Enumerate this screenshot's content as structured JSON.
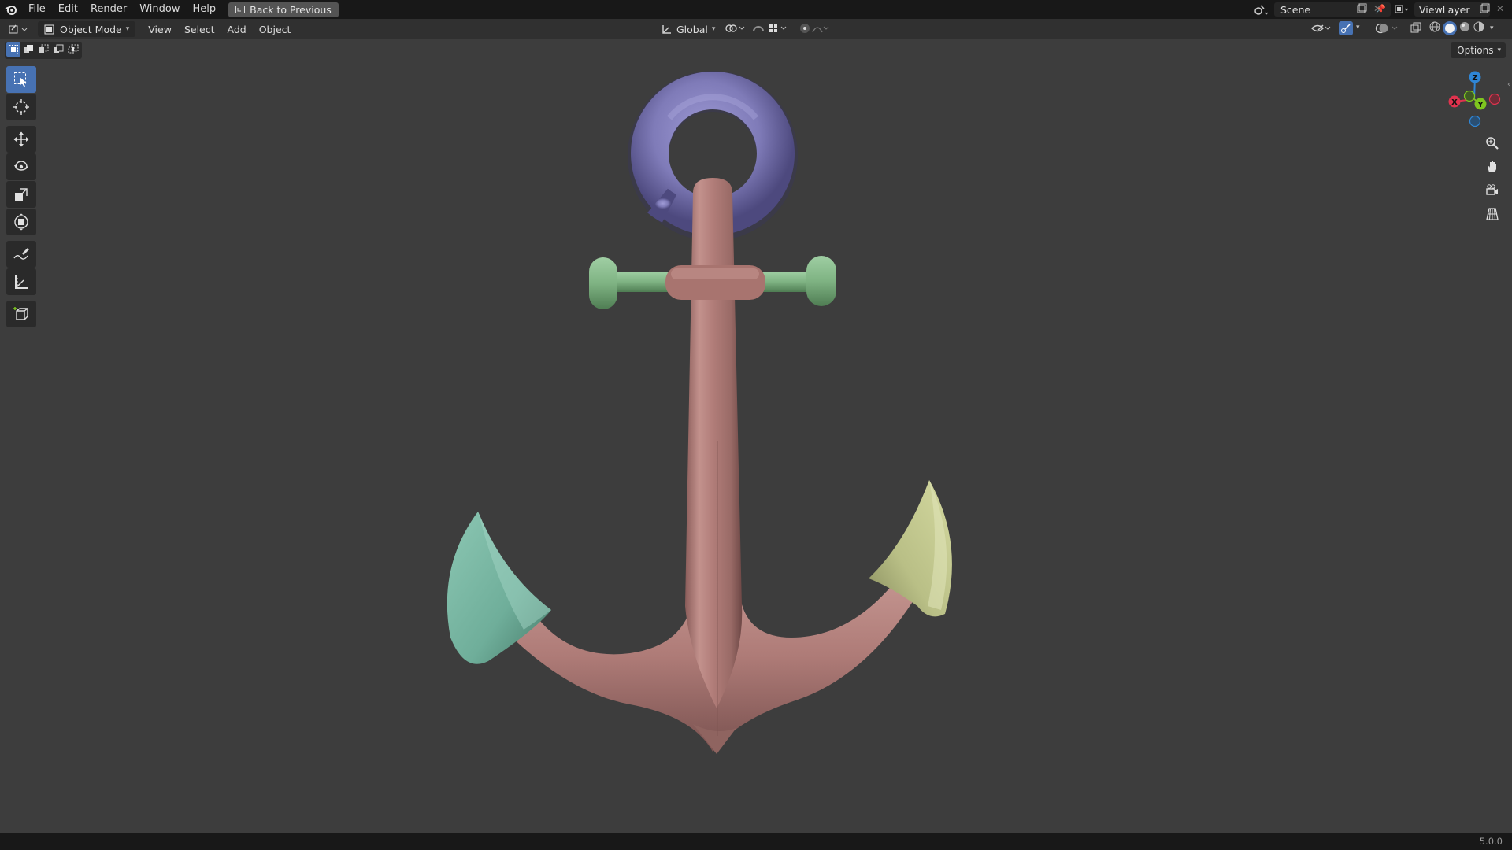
{
  "menu": {
    "items": [
      "File",
      "Edit",
      "Render",
      "Window",
      "Help"
    ],
    "back_label": "Back to Previous"
  },
  "scene": {
    "name": "Scene",
    "view_layer": "ViewLayer"
  },
  "header": {
    "mode": "Object Mode",
    "menus": [
      "View",
      "Select",
      "Add",
      "Object"
    ],
    "transform_orientation": "Global"
  },
  "viewport": {
    "options_label": "Options",
    "gizmo_axes": [
      "Z",
      "X",
      "Y"
    ]
  },
  "tools": [
    "select-box",
    "cursor",
    "move",
    "rotate",
    "scale",
    "transform",
    "annotate",
    "measure",
    "add-cube"
  ],
  "status": {
    "version": "5.0.0"
  },
  "colors": {
    "accent": "#4772b3",
    "anchor_shank": "#b07c78",
    "ring": "#7f7bb8",
    "stock": "#7fb383",
    "fluke_left": "#6fae9a",
    "fluke_right": "#b9bf86",
    "axis_x": "#e0334e",
    "axis_y": "#7ec51f",
    "axis_z": "#2f86d6"
  }
}
